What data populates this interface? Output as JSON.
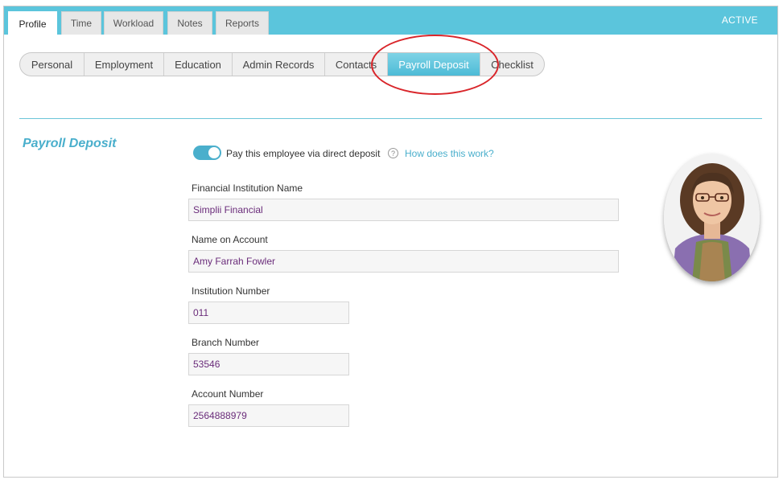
{
  "top_tabs": [
    "Profile",
    "Time",
    "Workload",
    "Notes",
    "Reports"
  ],
  "status": "ACTIVE",
  "sub_tabs": [
    "Personal",
    "Employment",
    "Education",
    "Admin Records",
    "Contacts",
    "Payroll Deposit",
    "Checklist"
  ],
  "section": {
    "title": "Payroll Deposit",
    "toggle_label": "Pay this employee via direct deposit",
    "toggle_on": true,
    "help_link": "How does this work?",
    "help_icon_glyph": "?"
  },
  "fields": {
    "institution_name": {
      "label": "Financial Institution Name",
      "value": "Simplii Financial"
    },
    "account_name": {
      "label": "Name on Account",
      "value": "Amy Farrah Fowler"
    },
    "institution_number": {
      "label": "Institution Number",
      "value": "011"
    },
    "branch_number": {
      "label": "Branch Number",
      "value": "53546"
    },
    "account_number": {
      "label": "Account Number",
      "value": "2564888979"
    }
  },
  "colors": {
    "accent": "#5bc5dc",
    "highlight_circle": "#d9252a",
    "field_value": "#6a2c7a"
  }
}
